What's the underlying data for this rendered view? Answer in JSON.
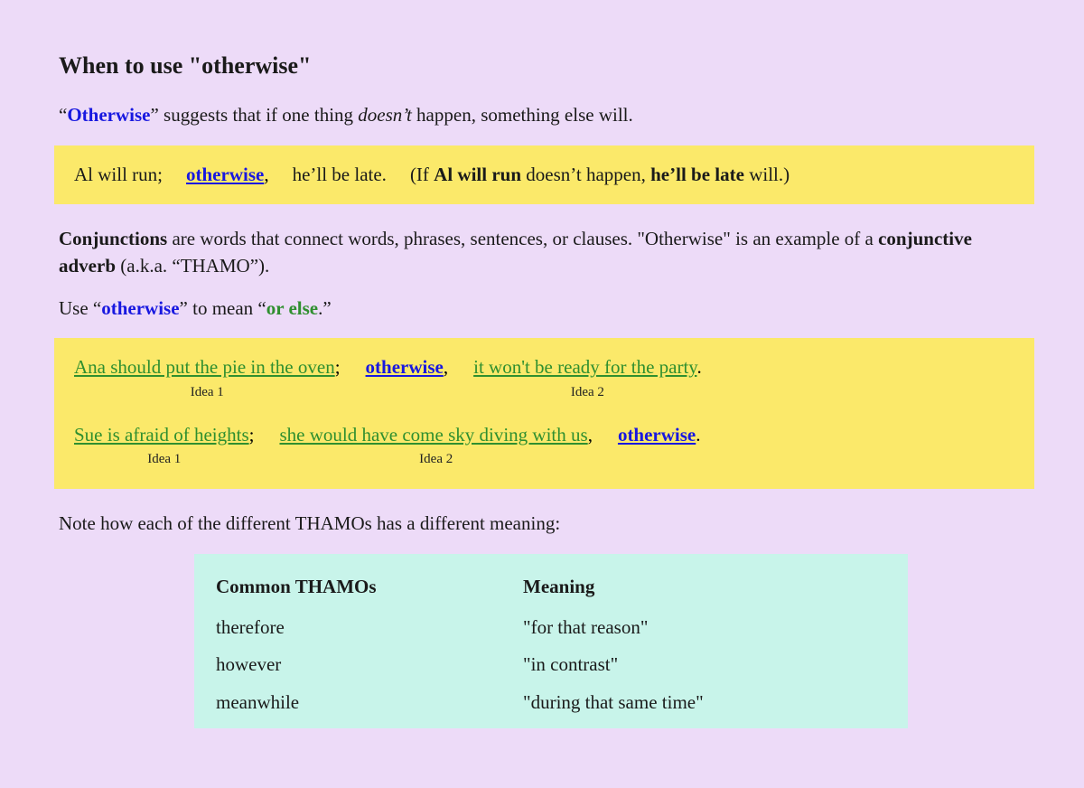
{
  "title": "When to use \"otherwise\"",
  "lead": {
    "q1": "“",
    "word": "Otherwise",
    "q2": "” suggests that if one thing ",
    "doesnt": "doesn’t",
    "after": " happen, something else will."
  },
  "ex1": {
    "clause1": "Al will run;",
    "conj": "otherwise",
    "comma": ",",
    "clause2": "he’ll be late.",
    "paren_pre": "(If ",
    "paren_b1": "Al will run",
    "paren_mid": " doesn’t happen, ",
    "paren_b2": "he’ll be late",
    "paren_post": " will.)"
  },
  "para2": {
    "t1": "Conjunctions",
    "t2": " are words that connect words, phrases, sentences, or clauses. \"Otherwise\" is an example of a ",
    "t3": "conjunctive adverb",
    "t4": " (a.k.a. “THAMO”)."
  },
  "para3": {
    "t1": "Use “",
    "w1": "otherwise",
    "t2": "” to mean “",
    "w2": "or else",
    "t3": ".”"
  },
  "ex2a": {
    "idea1": "Ana should put the pie in the oven",
    "semi": ";",
    "conj": "otherwise",
    "comma": ",",
    "idea2": "it won't be ready for the party",
    "period": ".",
    "lbl1": "Idea 1",
    "lbl2": "Idea 2"
  },
  "ex2b": {
    "idea1": "Sue is afraid of heights",
    "semi": ";",
    "idea2": "she would have come sky diving with us",
    "comma": ",",
    "conj": "otherwise",
    "period": ".",
    "lbl1": "Idea 1",
    "lbl2": "Idea 2"
  },
  "note": "Note how each of the different THAMOs has a different meaning:",
  "table": {
    "h1": "Common THAMOs",
    "h2": "Meaning",
    "rows": [
      {
        "c1": "therefore",
        "c2": "\"for that reason\""
      },
      {
        "c1": "however",
        "c2": "\"in contrast\""
      },
      {
        "c1": "meanwhile",
        "c2": "\"during that same time\""
      }
    ]
  }
}
